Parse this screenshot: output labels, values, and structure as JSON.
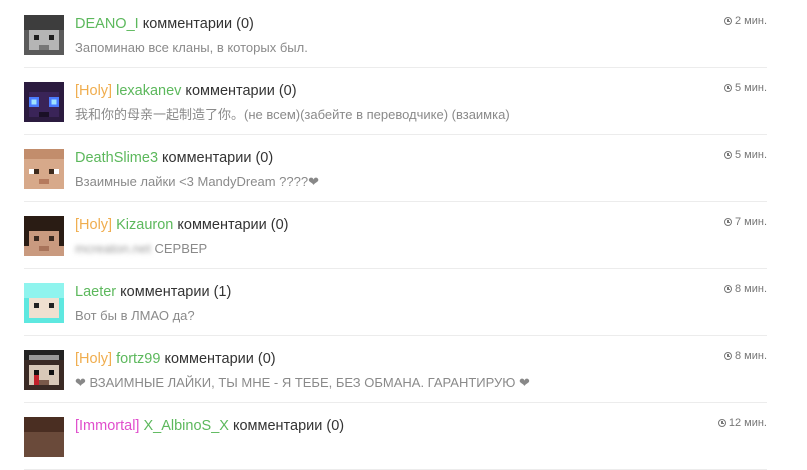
{
  "comments": [
    {
      "name": "DEANO_I",
      "action": " комментарии (0)",
      "text": "Запоминаю все кланы, в которых был.",
      "time": "2 мин."
    },
    {
      "prefix": "[Holy]",
      "name": "lexakanev",
      "action": " комментарии (0)",
      "text": "我和你的母亲一起制造了你。(не всем)(забейте в переводчике) (взаимка)",
      "time": "5 мин."
    },
    {
      "name": "DeathSlime3",
      "action": " комментарии (0)",
      "text": "Взаимные лайки <3 MandyDream ????",
      "text_suffix": "❤",
      "time": "5 мин."
    },
    {
      "prefix": "[Holy]",
      "name": "Kizauron",
      "action": " комментарии (0)",
      "text_blurred": "mcreaton.net",
      "text": " СЕРВЕР",
      "time": "7 мин."
    },
    {
      "name": "Laeter",
      "action": " комментарии (1)",
      "text": "Вот бы в ЛМАО да?",
      "time": "8 мин."
    },
    {
      "prefix": "[Holy]",
      "name": "fortz99",
      "action": " комментарии (0)",
      "text_prefix": "❤",
      "text": " ВЗАИМНЫЕ ЛАЙКИ, ТЫ МНЕ - Я ТЕБЕ, БЕЗ ОБМАНА. ГАРАНТИРУЮ ",
      "text_suffix": "❤",
      "time": "8 мин."
    },
    {
      "prefix": "[Immortal]",
      "name": "X_AlbinoS_X",
      "action": " комментарии (0)",
      "text": "",
      "time": "12 мин."
    }
  ]
}
